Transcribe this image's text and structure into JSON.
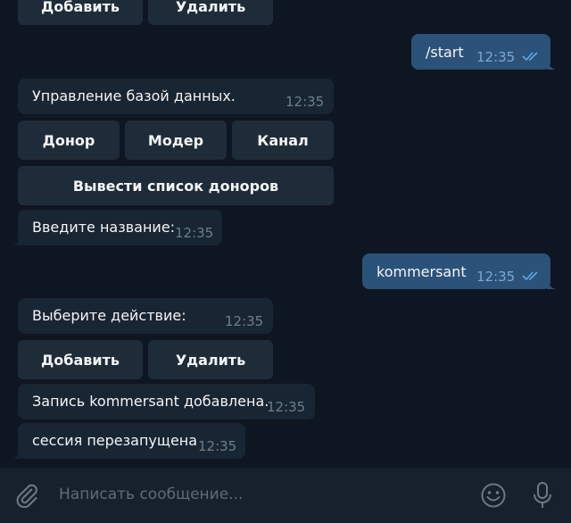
{
  "top_buttons": {
    "add": "Добавить",
    "delete": "Удалить"
  },
  "messages": {
    "start": {
      "text": "/start",
      "time": "12:35"
    },
    "db_menu": {
      "text": "Управление базой данных.",
      "time": "12:35"
    },
    "db_buttons": {
      "donor": "Донор",
      "moder": "Модер",
      "channel": "Канал",
      "list": "Вывести список доноров"
    },
    "enter_name": {
      "text": "Введите название:",
      "time": "12:35"
    },
    "kommersant": {
      "text": "kommersant",
      "time": "12:35"
    },
    "choose_action": {
      "text": "Выберите действие:",
      "time": "12:35"
    },
    "action_buttons": {
      "add": "Добавить",
      "delete": "Удалить"
    },
    "added": {
      "text": "Запись kommersant добавлена.",
      "time": "12:35"
    },
    "restarted": {
      "text": "сессия перезапущена",
      "time": "12:35"
    }
  },
  "composer": {
    "placeholder": "Написать сообщение..."
  },
  "icons": {
    "attach": "paperclip-icon",
    "emoji": "smile-icon",
    "voice": "microphone-icon",
    "read": "double-check-icon"
  },
  "colors": {
    "background": "#0e1621",
    "incoming": "#182533",
    "outgoing": "#2b5278",
    "button": "#1e2c3a",
    "accent": "#5ea8e8"
  }
}
